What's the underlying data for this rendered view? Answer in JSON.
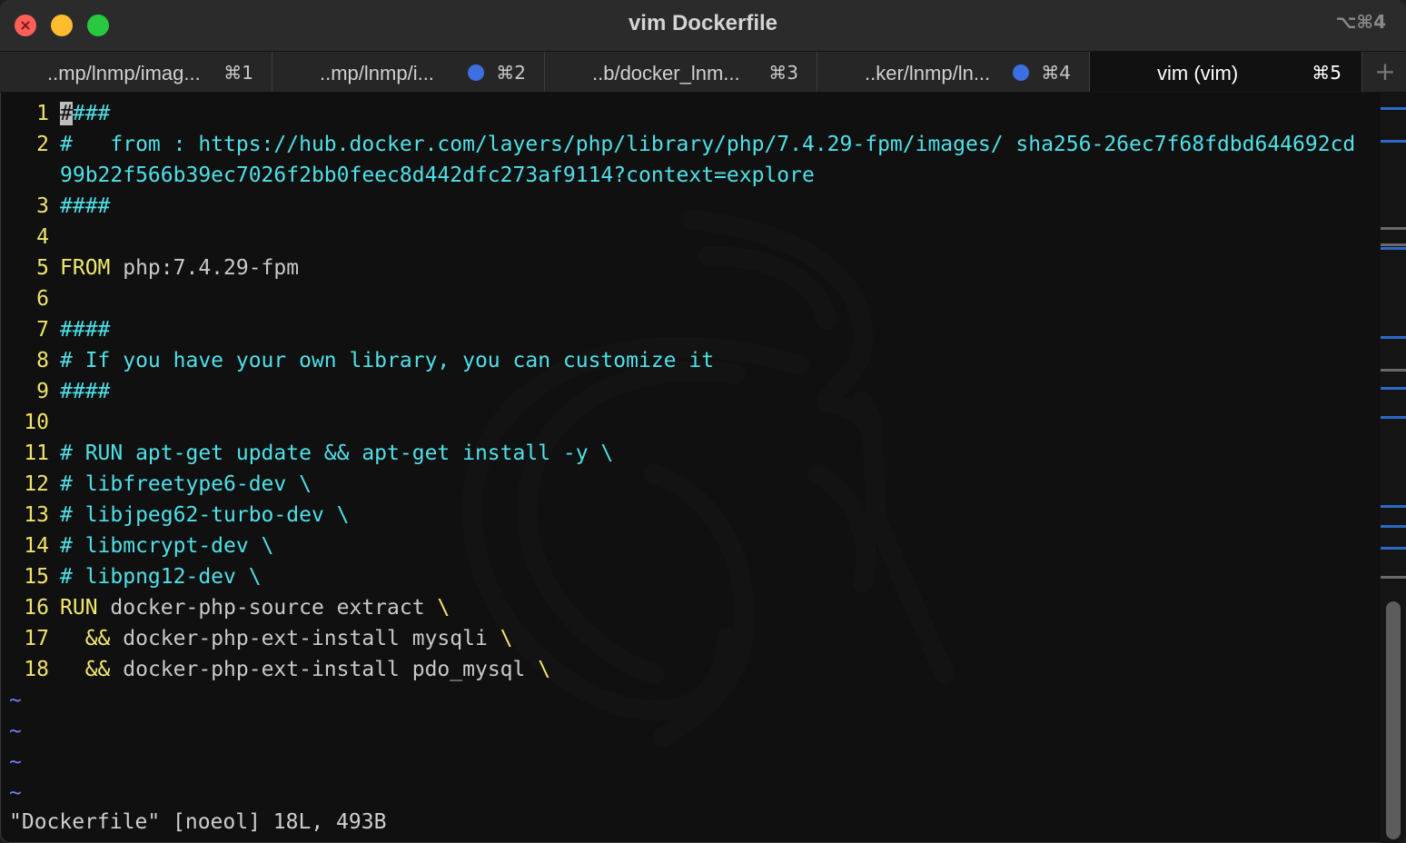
{
  "window": {
    "title": "vim Dockerfile",
    "title_shortcut": "⌥⌘4"
  },
  "tabs": [
    {
      "label": "..mp/lnmp/imag...",
      "shortcut": "⌘1",
      "dot": false,
      "active": false
    },
    {
      "label": "..mp/lnmp/i...",
      "shortcut": "⌘2",
      "dot": true,
      "active": false
    },
    {
      "label": "..b/docker_lnm...",
      "shortcut": "⌘3",
      "dot": false,
      "active": false
    },
    {
      "label": "..ker/lnmp/ln...",
      "shortcut": "⌘4",
      "dot": true,
      "active": false
    },
    {
      "label": "vim (vim)",
      "shortcut": "⌘5",
      "dot": false,
      "active": true
    }
  ],
  "new_tab_symbol": "+",
  "editor": {
    "lines": [
      {
        "n": "1",
        "parts": [
          {
            "t": "#",
            "cls": "cursor"
          },
          {
            "t": "###",
            "cls": "c-comment"
          }
        ]
      },
      {
        "n": "2",
        "parts": [
          {
            "t": "#   from : https://hub.docker.com/layers/php/library/php/7.4.29-fpm/images/ sha256-26ec7f68fdbd644692cd",
            "cls": "c-comment"
          }
        ]
      },
      {
        "n": "",
        "parts": [
          {
            "t": "99b22f566b39ec7026f2bb0feec8d442dfc273af9114?context=explore",
            "cls": "c-comment"
          }
        ]
      },
      {
        "n": "3",
        "parts": [
          {
            "t": "####",
            "cls": "c-comment"
          }
        ]
      },
      {
        "n": "4",
        "parts": []
      },
      {
        "n": "5",
        "parts": [
          {
            "t": "FROM",
            "cls": "c-kw"
          },
          {
            "t": " php:7.4.29-fpm",
            "cls": "c-plain"
          }
        ]
      },
      {
        "n": "6",
        "parts": []
      },
      {
        "n": "7",
        "parts": [
          {
            "t": "####",
            "cls": "c-comment"
          }
        ]
      },
      {
        "n": "8",
        "parts": [
          {
            "t": "# If you have your own library, you can customize it",
            "cls": "c-comment"
          }
        ]
      },
      {
        "n": "9",
        "parts": [
          {
            "t": "####",
            "cls": "c-comment"
          }
        ]
      },
      {
        "n": "10",
        "parts": []
      },
      {
        "n": "11",
        "parts": [
          {
            "t": "# RUN apt-get update && apt-get install -y \\",
            "cls": "c-comment"
          }
        ]
      },
      {
        "n": "12",
        "parts": [
          {
            "t": "# libfreetype6-dev \\",
            "cls": "c-comment"
          }
        ]
      },
      {
        "n": "13",
        "parts": [
          {
            "t": "# libjpeg62-turbo-dev \\",
            "cls": "c-comment"
          }
        ]
      },
      {
        "n": "14",
        "parts": [
          {
            "t": "# libmcrypt-dev \\",
            "cls": "c-comment"
          }
        ]
      },
      {
        "n": "15",
        "parts": [
          {
            "t": "# libpng12-dev \\",
            "cls": "c-comment"
          }
        ]
      },
      {
        "n": "16",
        "parts": [
          {
            "t": "RUN",
            "cls": "c-kw"
          },
          {
            "t": " docker-php-source extract ",
            "cls": "c-plain"
          },
          {
            "t": "\\",
            "cls": "c-kw"
          }
        ]
      },
      {
        "n": "17",
        "parts": [
          {
            "t": "  ",
            "cls": "c-plain"
          },
          {
            "t": "&&",
            "cls": "c-kw"
          },
          {
            "t": " docker-php-ext-install mysqli ",
            "cls": "c-plain"
          },
          {
            "t": "\\",
            "cls": "c-kw"
          }
        ]
      },
      {
        "n": "18",
        "parts": [
          {
            "t": "  ",
            "cls": "c-plain"
          },
          {
            "t": "&&",
            "cls": "c-kw"
          },
          {
            "t": " docker-php-ext-install pdo_mysql ",
            "cls": "c-plain"
          },
          {
            "t": "\\",
            "cls": "c-kw"
          }
        ]
      }
    ],
    "empty_line_marker": "~",
    "empty_line_count": 4,
    "status_message": "\"Dockerfile\" [noeol] 18L, 493B"
  },
  "scrollbar_marks": [
    {
      "color": "blue"
    },
    {
      "color": "blue"
    },
    {
      "color": "gray"
    },
    {
      "color": "gray"
    },
    {
      "color": "blue"
    },
    {
      "color": "blue"
    },
    {
      "color": "gray"
    },
    {
      "color": "blue"
    },
    {
      "color": "blue"
    },
    {
      "color": "blue"
    },
    {
      "color": "blue"
    },
    {
      "color": "blue"
    },
    {
      "color": "gray"
    }
  ],
  "colors": {
    "line_number": "#f0e36b",
    "comment": "#4fe0e8",
    "keyword": "#f2e86e",
    "plain": "#c9c9c9",
    "tilde": "#6f7df2",
    "tab_dot": "#3d6fe0"
  },
  "icons": [
    "close-icon",
    "minimize-icon",
    "zoom-icon",
    "plus-icon",
    "kali-dragon-watermark-icon"
  ]
}
